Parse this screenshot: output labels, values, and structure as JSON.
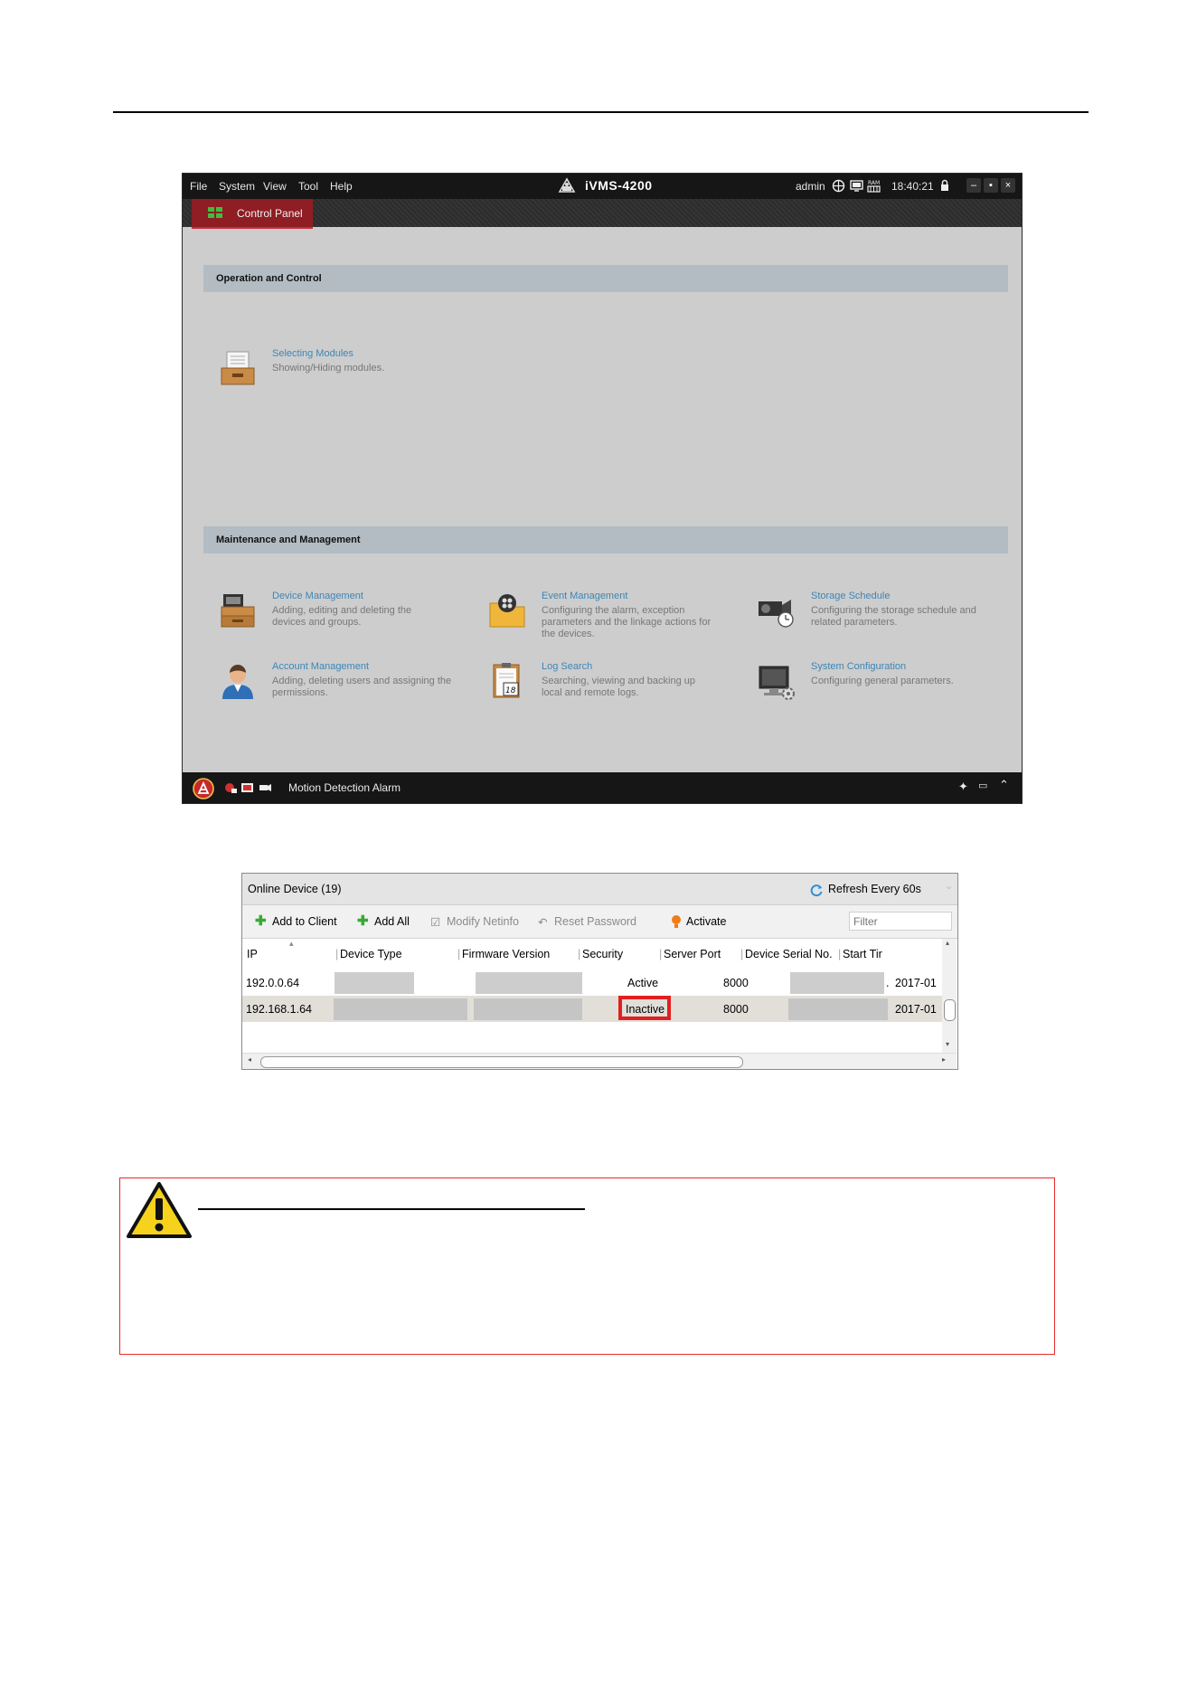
{
  "window": {
    "menu": [
      "File",
      "System",
      "View",
      "Tool",
      "Help"
    ],
    "app_title": "iVMS-4200",
    "user": "admin",
    "time": "18:40:21",
    "active_tab": "Control Panel",
    "sections": {
      "operation": "Operation and Control",
      "maintenance": "Maintenance and Management"
    },
    "modules": {
      "selecting": {
        "title": "Selecting Modules",
        "desc": "Showing/Hiding modules."
      },
      "device": {
        "title": "Device Management",
        "desc": "Adding, editing and deleting the devices and groups."
      },
      "event": {
        "title": "Event Management",
        "desc": "Configuring the alarm, exception parameters and the linkage actions for the devices."
      },
      "storage": {
        "title": "Storage Schedule",
        "desc": "Configuring the storage schedule and related parameters."
      },
      "account": {
        "title": "Account Management",
        "desc": "Adding, deleting users and assigning the permissions."
      },
      "log": {
        "title": "Log Search",
        "desc": "Searching, viewing and backing up local and remote logs."
      },
      "system": {
        "title": "System Configuration",
        "desc": "Configuring general parameters."
      }
    },
    "status": {
      "alarm_label": "Motion Detection Alarm"
    },
    "colors": {
      "tab_red": "#8e1e24",
      "link_blue": "#3c86b8",
      "section_bar": "#b3bcc3"
    }
  },
  "panel": {
    "title": "Online Device (19)",
    "refresh_label": "Refresh Every 60s",
    "toolbar": {
      "add_to_client": "Add to Client",
      "add_all": "Add All",
      "modify_netinfo": "Modify Netinfo",
      "reset_password": "Reset Password",
      "activate": "Activate",
      "filter_placeholder": "Filter"
    },
    "columns": [
      "IP",
      "Device Type",
      "Firmware Version",
      "Security",
      "Server Port",
      "Device Serial No.",
      "Start Tir"
    ],
    "rows": [
      {
        "ip": "192.0.0.64",
        "security": "Active",
        "port": "8000",
        "serial_tail": ".",
        "start": "2017-01"
      },
      {
        "ip": "192.168.1.64",
        "security": "Inactive",
        "port": "8000",
        "serial_tail": "",
        "start": "2017-01"
      }
    ],
    "highlight_color": "#e02020"
  },
  "note": {
    "border_color": "#e32b2b",
    "icon": "warning-triangle-icon"
  }
}
